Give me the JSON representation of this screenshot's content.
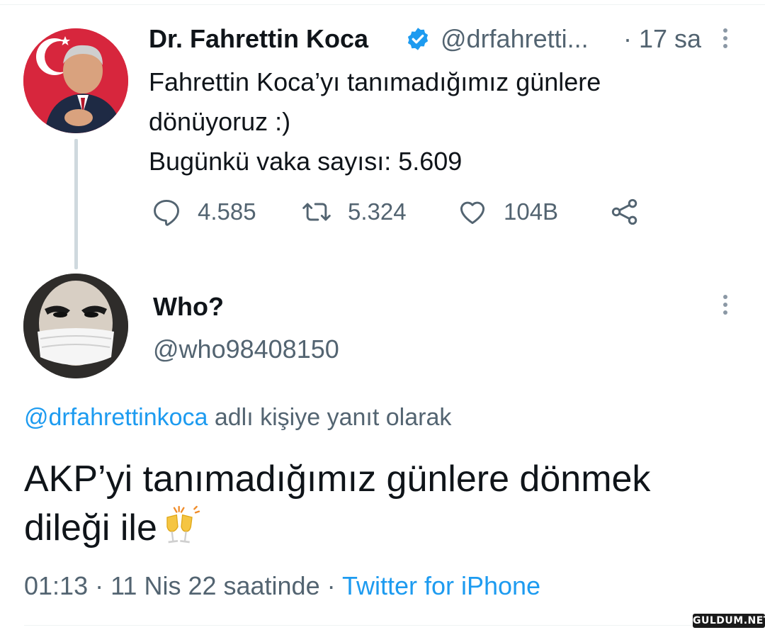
{
  "colors": {
    "link": "#1d9bf0",
    "secondary": "#536471",
    "text": "#0f1419",
    "verified": "#1d9bf0"
  },
  "tweet": {
    "author_name": "Dr. Fahrettin Koca",
    "handle": "@drfahretti...",
    "time": "· 17 sa",
    "text_lines": [
      "Fahrettin Koca’yı tanımadığımız günlere",
      "dönüyoruz :)",
      "Bugünkü vaka sayısı: 5.609"
    ],
    "actions": {
      "replies": "4.585",
      "retweets": "5.324",
      "likes": "104B"
    }
  },
  "reply": {
    "author_name": "Who?",
    "handle": "@who98408150",
    "reply_to_handle": "@drfahrettinkoca",
    "reply_to_suffix": " adlı kişiye yanıt olarak",
    "text_lines": [
      "AKP’yi tanımadığımız günlere dönmek",
      "dileği ile"
    ],
    "emoji": "clinking-glasses",
    "timestamp": "01:13 · 11 Nis 22 saatinde · ",
    "source": "Twitter for iPhone"
  },
  "watermark": "GULDUM.NET"
}
